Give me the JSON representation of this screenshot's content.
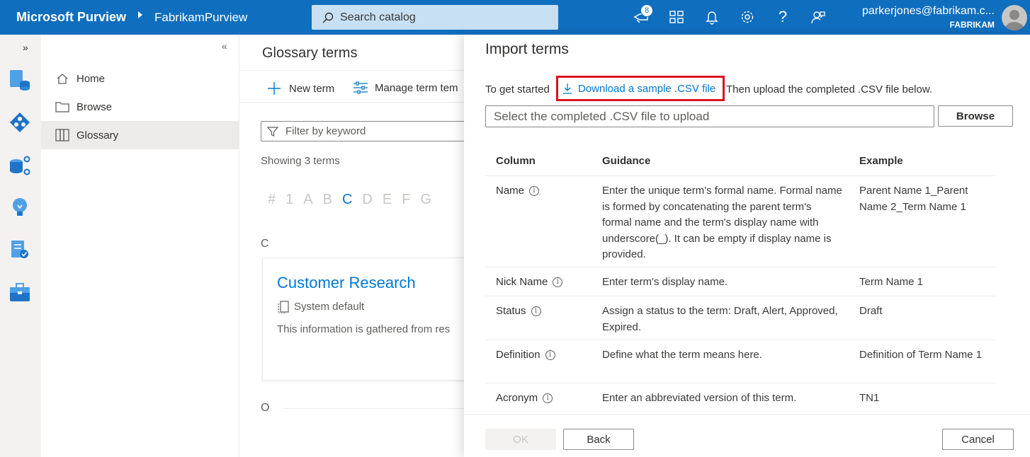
{
  "header": {
    "brand": "Microsoft Purview",
    "tenant": "FabrikamPurview",
    "search_placeholder": "Search catalog",
    "notification_count": "8",
    "user_email": "parkerjones@fabrikam.c...",
    "user_org": "FABRIKAM",
    "accent": "#106ebe"
  },
  "nav": {
    "items": [
      {
        "label": "Home",
        "icon": "home-icon"
      },
      {
        "label": "Browse",
        "icon": "folder-icon"
      },
      {
        "label": "Glossary",
        "icon": "book-icon"
      }
    ],
    "active": "Glossary"
  },
  "main": {
    "title": "Glossary terms",
    "new_term": "New term",
    "manage_term": "Manage term tem",
    "filter_placeholder": "Filter by keyword",
    "showing": "Showing 3 terms",
    "alphabet": [
      "#",
      "1",
      "A",
      "B",
      "C",
      "D",
      "E",
      "F",
      "G"
    ],
    "selected_letter": "C",
    "section_c": "C",
    "card": {
      "title": "Customer Research",
      "sub": "System default",
      "desc": "This information is gathered from res"
    },
    "section_o": "O"
  },
  "panel": {
    "title": "Import terms",
    "get_started": "To get started",
    "download_link": "Download a sample .CSV file",
    "then_upload": "Then upload the completed .CSV file below.",
    "file_placeholder": "Select the completed .CSV file to upload",
    "browse": "Browse",
    "columns": {
      "column": "Column",
      "guidance": "Guidance",
      "example": "Example"
    },
    "rows": [
      {
        "column": "Name",
        "guidance": "Enter the unique term's formal name. Formal name is formed by concatenating the parent term's formal name and the term's display name with underscore(_). It can be empty if display name is provided.",
        "example": "Parent Name 1_Parent Name 2_Term Name 1"
      },
      {
        "column": "Nick Name",
        "guidance": "Enter term's display name.",
        "example": "Term Name 1"
      },
      {
        "column": "Status",
        "guidance": "Assign a status to the term: Draft, Alert, Approved, Expired.",
        "example": "Draft"
      },
      {
        "column": "Definition",
        "guidance": "Define what the term means here.",
        "example": "Definition of Term Name 1"
      },
      {
        "column": "Acronym",
        "guidance": "Enter an abbreviated version of this term.",
        "example": "TN1"
      }
    ],
    "ok": "OK",
    "back": "Back",
    "cancel": "Cancel",
    "highlight_color": "#d8141e"
  }
}
